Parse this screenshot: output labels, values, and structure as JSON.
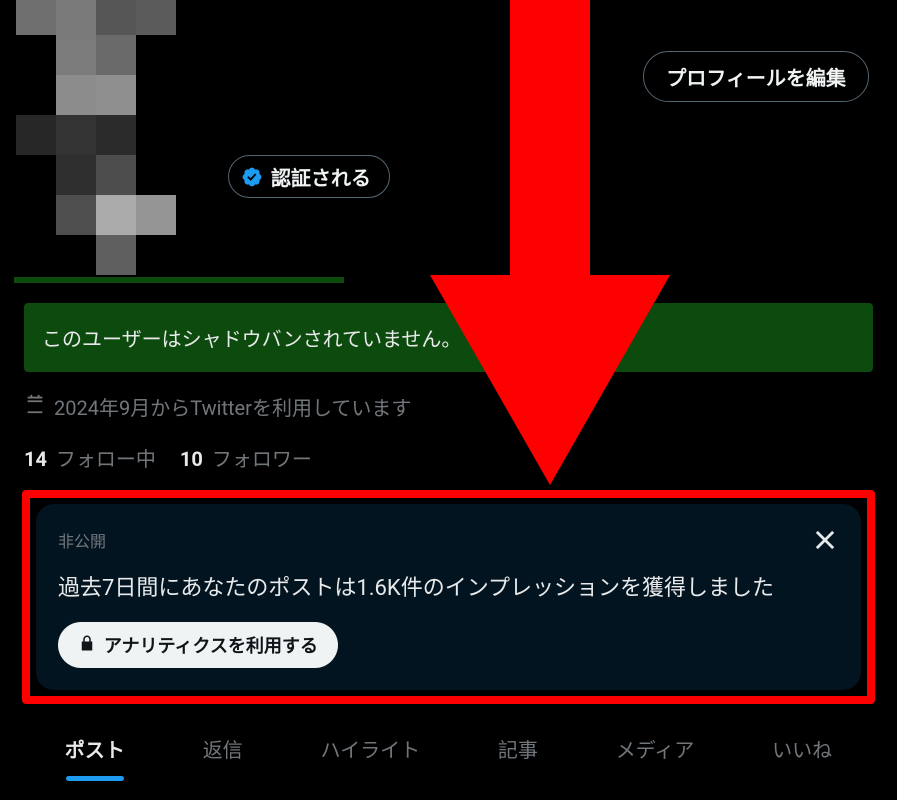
{
  "header": {
    "edit_profile_label": "プロフィールを編集",
    "verify_label": "認証される"
  },
  "shadowban": {
    "message": "このユーザーはシャドウバンされていません。"
  },
  "join": {
    "text": "2024年9月からTwitterを利用しています"
  },
  "follow": {
    "following_count": "14",
    "following_label": "フォロー中",
    "followers_count": "10",
    "followers_label": "フォロワー"
  },
  "analytics": {
    "private_label": "非公開",
    "summary": "過去7日間にあなたのポストは1.6K件のインプレッションを獲得しました",
    "button_label": "アナリティクスを利用する"
  },
  "tabs": {
    "items": [
      {
        "label": "ポスト",
        "active": true
      },
      {
        "label": "返信",
        "active": false
      },
      {
        "label": "ハイライト",
        "active": false
      },
      {
        "label": "記事",
        "active": false
      },
      {
        "label": "メディア",
        "active": false
      },
      {
        "label": "いいね",
        "active": false
      }
    ]
  },
  "colors": {
    "verified_blue": "#1d9bf0",
    "highlight_red": "#ff0000",
    "banner_green": "#0d4a0d"
  }
}
